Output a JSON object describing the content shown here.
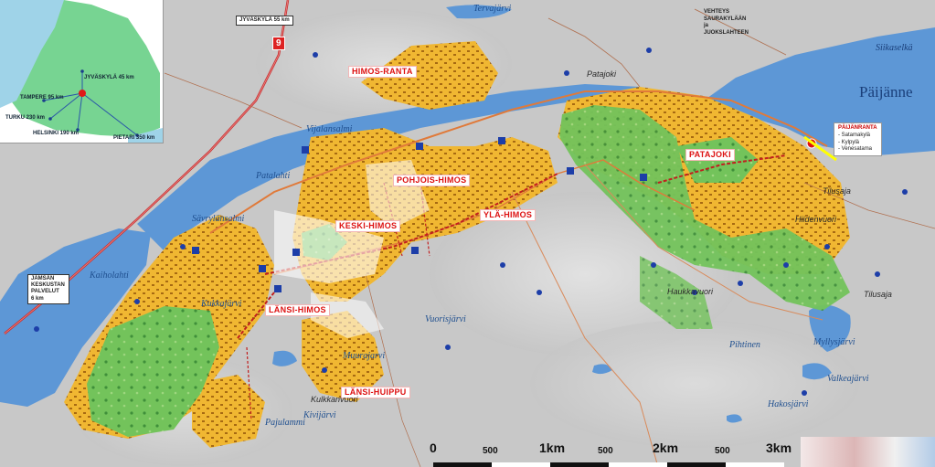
{
  "inset": {
    "cities": [
      {
        "name": "JYVÄSKYLÄ 45 km"
      },
      {
        "name": "TAMPERE 95 km"
      },
      {
        "name": "TURKU 230 km"
      },
      {
        "name": "HELSINKI 190 km"
      },
      {
        "name": "PIETARI 350 km"
      }
    ]
  },
  "signs": {
    "jyvaskyla": "JYVÄSKYLÄ 55 km",
    "road_number": "9",
    "jamsa": [
      "JÄMSÄN",
      "KESKUSTAN",
      "PALVELUT",
      "6 km"
    ],
    "vehtee": [
      "VEHTEYS",
      "SAURAKYLÄÄN",
      "ja",
      "JUOKSLAHTEEN"
    ]
  },
  "areas": {
    "himos_ranta": "HIMOS-RANTA",
    "pohjois_himos": "POHJOIS-HIMOS",
    "keski_himos": "KESKI-HIMOS",
    "yla_himos": "YLÄ-HIMOS",
    "lansi_himos": "LÄNSI-HIMOS",
    "lansi_huippu": "LÄNSI-HUIPPU",
    "patajoki": "PATAJOKI"
  },
  "lake_big": "Päijänne",
  "waters": {
    "tervajarvi": "Tervajärvi",
    "vijalansalmi": "Vijalansalmi",
    "patalahti": "Patalahti",
    "savrylansalmi": "Sävrylänsalmi",
    "kaiholahti": "Kaiholahti",
    "kukkajarvi": "Kukkajärvi",
    "muurajarvi": "Muurajarvi",
    "vuorisjarvi": "Vuorisjärvi",
    "pajulammi": "Pajulammi",
    "kivijarvi": "Kivijärvi",
    "haukkavuori": "Haukkavuori",
    "pihtinen": "Pihtinen",
    "myllysjarvi": "Myllysjärvi",
    "valkeajarvi": "Valkeajärvi",
    "hakosjarvi": "Hakosjärvi",
    "siikaselka": "Siikaselkä",
    "patajoki_w": "Patajoki",
    "hiidenvuori": "Hiidenvuori",
    "tiilusaja": "Tilusaja",
    "tilusaja2": "Tilusaja",
    "kulkkanvuori": "Kulkkanvuori",
    "muurajarvi2": "Muurajärvi"
  },
  "legend": {
    "title": "PÄIJÄNRANTA",
    "items": [
      "- Satamakylä",
      "- Kylpylä",
      "- Venesatama"
    ]
  },
  "scale": {
    "labels": [
      "0",
      "500",
      "1km",
      "500",
      "2km",
      "500",
      "3km"
    ]
  },
  "colors": {
    "terrain": "#c8c8c8",
    "water": "#5d97d6",
    "cabins": "#f0b732",
    "golf": "#6fbf5a",
    "road": "#e07a3a",
    "ski_lift": "#c11f1f"
  }
}
